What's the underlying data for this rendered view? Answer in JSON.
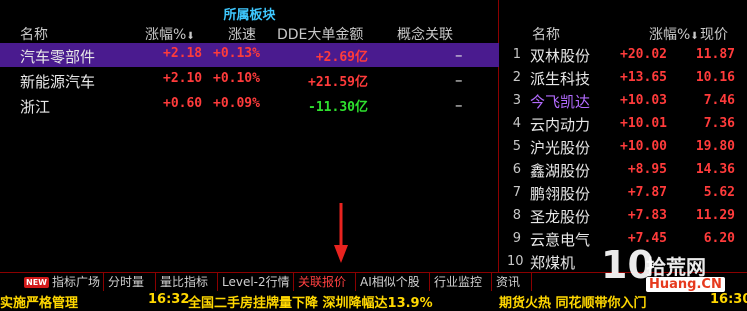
{
  "panel": {
    "title": "所属板块"
  },
  "left_headers": {
    "name": "名称",
    "change": "涨幅%",
    "speed": "涨速",
    "dde": "DDE大单金额",
    "concept": "概念关联"
  },
  "left_rows": [
    {
      "name": "汽车零部件",
      "change": "+2.18",
      "speed": "+0.13%",
      "dde": "+2.69亿",
      "concept": "–",
      "selected": true,
      "dde_color": "red"
    },
    {
      "name": "新能源汽车",
      "change": "+2.10",
      "speed": "+0.10%",
      "dde": "+21.59亿",
      "concept": "–",
      "selected": false,
      "dde_color": "red"
    },
    {
      "name": "浙江",
      "change": "+0.60",
      "speed": "+0.09%",
      "dde": "-11.30亿",
      "concept": "–",
      "selected": false,
      "dde_color": "green"
    }
  ],
  "right_headers": {
    "name": "名称",
    "change": "涨幅%",
    "price": "现价"
  },
  "right_rows": [
    {
      "idx": "1",
      "name": "双林股份",
      "change": "+20.02",
      "price": "11.87",
      "name_color": "white"
    },
    {
      "idx": "2",
      "name": "派生科技",
      "change": "+13.65",
      "price": "10.16",
      "name_color": "white"
    },
    {
      "idx": "3",
      "name": "今飞凯达",
      "change": "+10.03",
      "price": "7.46",
      "name_color": "purple"
    },
    {
      "idx": "4",
      "name": "云内动力",
      "change": "+10.01",
      "price": "7.36",
      "name_color": "white"
    },
    {
      "idx": "5",
      "name": "沪光股份",
      "change": "+10.00",
      "price": "19.80",
      "name_color": "white"
    },
    {
      "idx": "6",
      "name": "鑫湖股份",
      "change": "+8.95",
      "price": "14.36",
      "name_color": "white"
    },
    {
      "idx": "7",
      "name": "鹏翎股份",
      "change": "+7.87",
      "price": "5.62",
      "name_color": "white"
    },
    {
      "idx": "8",
      "name": "圣龙股份",
      "change": "+7.83",
      "price": "11.29",
      "name_color": "white"
    },
    {
      "idx": "9",
      "name": "云意电气",
      "change": "+7.45",
      "price": "6.20",
      "name_color": "white"
    },
    {
      "idx": "10",
      "name": "郑煤机",
      "change": "",
      "price": "",
      "name_color": "white"
    }
  ],
  "tabs": {
    "new_badge": "NEW",
    "items": [
      "指标广场",
      "分时量",
      "量比指标",
      "Level-2行情",
      "关联报价",
      "AI相似个股",
      "行业监控",
      "资讯"
    ],
    "active_index": 4
  },
  "ticker": {
    "left_fragment": "实施严格管理",
    "time": "16:32",
    "headline": "全国二手房挂牌量下降 深圳降幅达13.9%",
    "right_fragment": "期货火热 同花顺带你入门",
    "time_right": "16:30"
  },
  "watermark": {
    "big": "10",
    "cn": "拾荒网",
    "url": "Huang.CN"
  },
  "colors": {
    "accent_red": "#ff3b3b",
    "green": "#2ee02e",
    "selected_row": "#4a1b8f",
    "title_cyan": "#3ec8ff",
    "ticker_yellow": "#ffd700"
  }
}
